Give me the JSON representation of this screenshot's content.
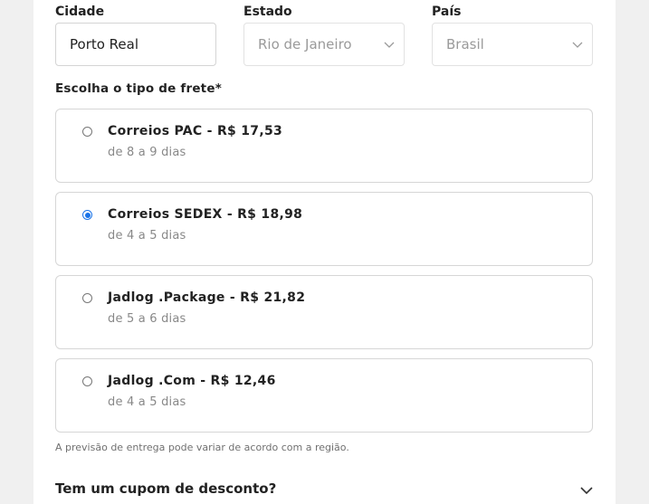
{
  "address": {
    "city": {
      "label": "Cidade",
      "value": "Porto Real"
    },
    "state": {
      "label": "Estado",
      "value": "Rio de Janeiro"
    },
    "country": {
      "label": "País",
      "value": "Brasil"
    }
  },
  "shipping": {
    "label": "Escolha o tipo de frete*",
    "options": [
      {
        "title": "Correios PAC - R$ 17,53",
        "subtitle": "de 8 a 9 dias",
        "selected": false
      },
      {
        "title": "Correios SEDEX - R$ 18,98",
        "subtitle": "de 4 a 5 dias",
        "selected": true
      },
      {
        "title": "Jadlog .Package - R$ 21,82",
        "subtitle": "de 5 a 6 dias",
        "selected": false
      },
      {
        "title": "Jadlog .Com - R$ 12,46",
        "subtitle": "de 4 a 5 dias",
        "selected": false
      }
    ],
    "note": "A previsão de entrega pode variar de acordo com a região."
  },
  "coupon": {
    "label": "Tem um cupom de desconto?"
  },
  "colors": {
    "accent": "#1a73e8",
    "border": "#d6d6d6",
    "muted": "#888888"
  }
}
